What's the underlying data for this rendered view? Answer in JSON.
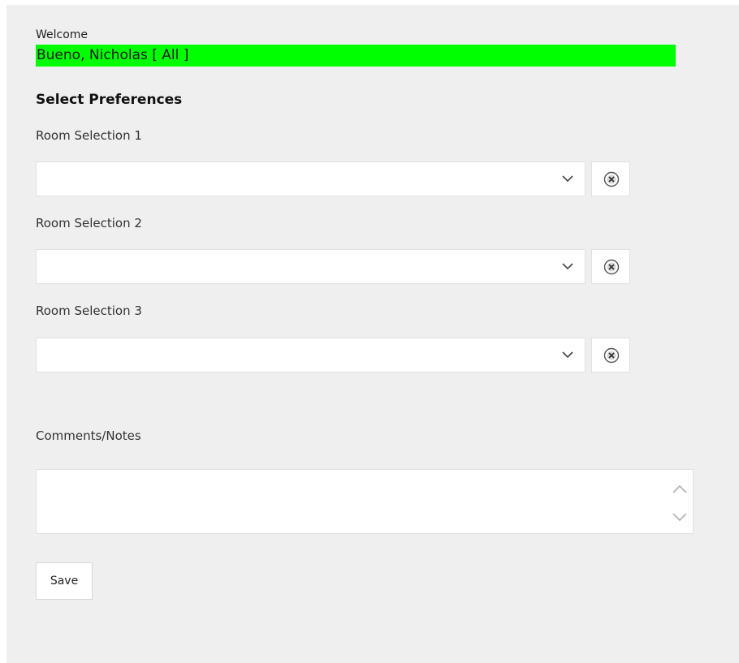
{
  "welcome": {
    "label": "Welcome",
    "name": "Bueno, Nicholas [ All ]",
    "highlight_color": "#00ff00"
  },
  "preferences": {
    "title": "Select Preferences",
    "rooms": [
      {
        "label": "Room Selection 1",
        "value": ""
      },
      {
        "label": "Room Selection 2",
        "value": ""
      },
      {
        "label": "Room Selection 3",
        "value": ""
      }
    ]
  },
  "notes": {
    "label": "Comments/Notes",
    "value": ""
  },
  "actions": {
    "save_label": "Save"
  },
  "icons": {
    "dropdown": "chevron-down-icon",
    "clear": "close-circle-icon",
    "scroll_up": "chevron-up-icon",
    "scroll_down": "chevron-down-icon"
  }
}
